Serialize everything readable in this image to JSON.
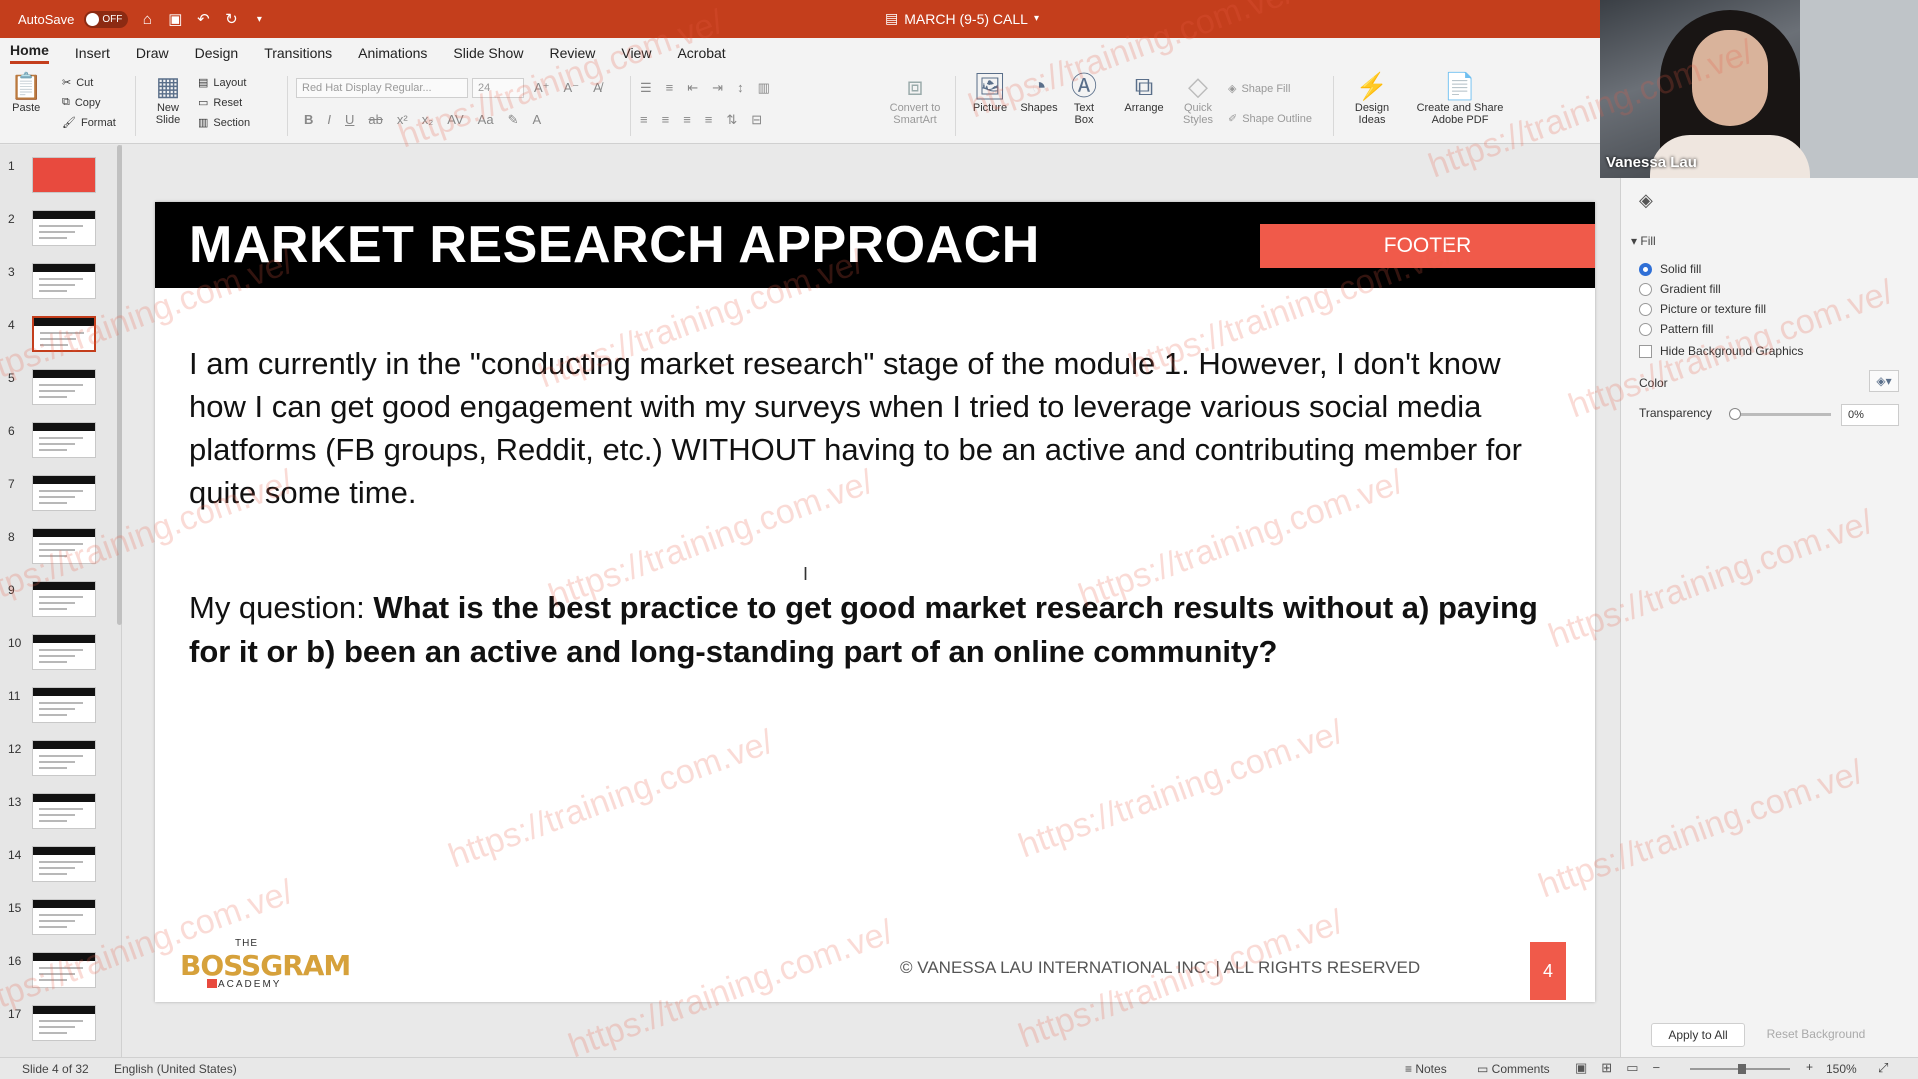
{
  "titlebar": {
    "autosave_label": "AutoSave",
    "autosave_state": "OFF",
    "document_title": "MARCH (9-5) CALL",
    "accent": "#c43e1c"
  },
  "tabs": [
    "Home",
    "Insert",
    "Draw",
    "Design",
    "Transitions",
    "Animations",
    "Slide Show",
    "Review",
    "View",
    "Acrobat"
  ],
  "ribbon": {
    "paste": "Paste",
    "cut": "Cut",
    "copy": "Copy",
    "format": "Format",
    "new_slide": "New Slide",
    "layout": "Layout",
    "reset": "Reset",
    "section": "Section",
    "font_name": "Red Hat Display Regular...",
    "font_size": "24",
    "convert_smartart": "Convert to SmartArt",
    "picture": "Picture",
    "shapes": "Shapes",
    "text_box": "Text Box",
    "arrange": "Arrange",
    "quick_styles": "Quick Styles",
    "shape_fill": "Shape Fill",
    "shape_outline": "Shape Outline",
    "design_ideas": "Design Ideas",
    "create_share_pdf": "Create and Share Adobe PDF"
  },
  "thumbnails": {
    "numbers": [
      "1",
      "2",
      "3",
      "4",
      "5",
      "6",
      "7",
      "8",
      "9",
      "10",
      "11",
      "12",
      "13",
      "14",
      "15",
      "16",
      "17"
    ],
    "active": "4"
  },
  "slide": {
    "title": "MARKET RESEARCH APPROACH",
    "footer_label": "FOOTER",
    "body": "I am currently in the \"conducting market research\" stage of the module 1. However, I don't know how I can get good engagement with my surveys when I tried to leverage various social media platforms (FB groups, Reddit, etc.) WITHOUT having to be an active and contributing member for quite some time.",
    "question_prefix": "My question: ",
    "question_bold": "What is the best practice to get good market research results without a) paying for it or b) been an active and long-standing part of an online community?",
    "logo_the": "THE",
    "logo_main": "BOSSGRAM",
    "logo_academy": "ACADEMY",
    "copyright": "© VANESSA LAU INTERNATIONAL INC. | ALL RIGHTS RESERVED",
    "number": "4",
    "accent": "#f05a4a"
  },
  "webcam": {
    "name": "Vanessa Lau"
  },
  "format_pane": {
    "fill_heading": "Fill",
    "options": [
      "Solid fill",
      "Gradient fill",
      "Picture or texture fill",
      "Pattern fill"
    ],
    "selected_option": "Solid fill",
    "hide_bg_graphics": "Hide Background Graphics",
    "color_label": "Color",
    "transparency_label": "Transparency",
    "transparency_value": "0%",
    "apply_all": "Apply to All",
    "reset_background": "Reset Background"
  },
  "statusbar": {
    "slide_info": "Slide 4 of 32",
    "language": "English (United States)",
    "notes": "Notes",
    "comments": "Comments",
    "zoom": "150%"
  },
  "watermark": "https://training.com.ve/"
}
